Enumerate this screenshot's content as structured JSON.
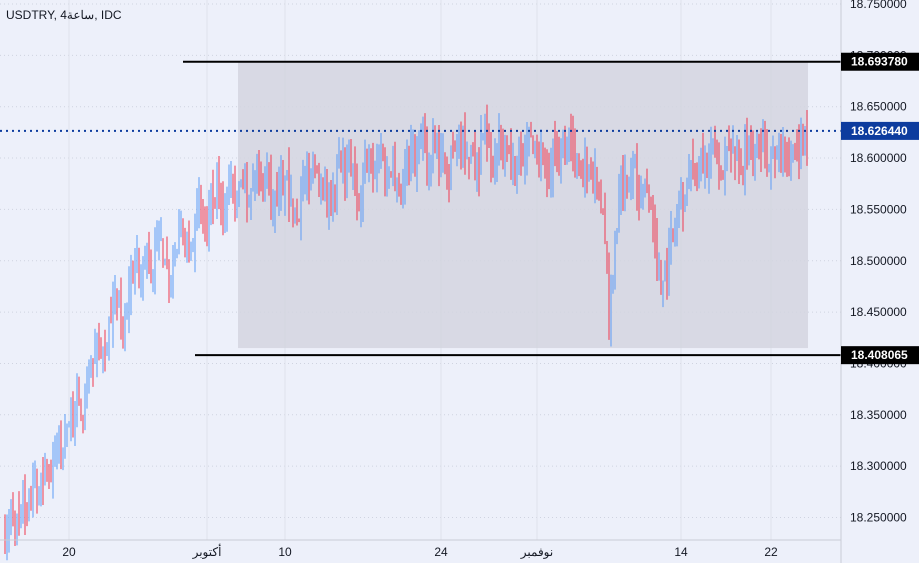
{
  "header": {
    "title": "USDTRY, 4ساعة, IDC"
  },
  "colors": {
    "up": "#5b9cf6",
    "down": "#f0394f",
    "last_price": "#0d3c9e",
    "levels": "#000000",
    "range_box": "#d3d5df"
  },
  "chart_data": {
    "type": "candlestick",
    "title": "USDTRY, 4ساعة, IDC",
    "ylim": [
      18.23,
      18.755
    ],
    "y_ticks": [
      "18.750000",
      "18.700000",
      "18.650000",
      "18.600000",
      "18.550000",
      "18.500000",
      "18.450000",
      "18.400000",
      "18.350000",
      "18.300000",
      "18.250000"
    ],
    "y_tick_values": [
      18.75,
      18.7,
      18.65,
      18.6,
      18.55,
      18.5,
      18.45,
      18.4,
      18.35,
      18.3,
      18.25
    ],
    "x_ticks": [
      {
        "label": "20",
        "index": 11
      },
      {
        "label": "أكتوبر",
        "index": 34
      },
      {
        "label": "10",
        "index": 47
      },
      {
        "label": "24",
        "index": 73
      },
      {
        "label": "نوفمبر",
        "index": 89
      },
      {
        "label": "14",
        "index": 113
      },
      {
        "label": "22",
        "index": 128
      }
    ],
    "closes": [
      18.23,
      18.25,
      18.24,
      18.26,
      18.25,
      18.28,
      18.27,
      18.3,
      18.29,
      18.32,
      18.31,
      18.34,
      18.36,
      18.35,
      18.38,
      18.4,
      18.42,
      18.41,
      18.44,
      18.46,
      18.43,
      18.47,
      18.5,
      18.48,
      18.51,
      18.49,
      18.52,
      18.5,
      18.48,
      18.51,
      18.53,
      18.5,
      18.54,
      18.55,
      18.53,
      18.56,
      18.57,
      18.55,
      18.58,
      18.56,
      18.57,
      18.56,
      18.58,
      18.57,
      18.59,
      18.55,
      18.57,
      18.58,
      18.56,
      18.54,
      18.58,
      18.57,
      18.59,
      18.58,
      18.55,
      18.57,
      18.6,
      18.58,
      18.59,
      18.56,
      18.58,
      18.6,
      18.59,
      18.61,
      18.58,
      18.6,
      18.57,
      18.59,
      18.61,
      18.6,
      18.62,
      18.59,
      18.61,
      18.6,
      18.58,
      18.61,
      18.62,
      18.6,
      18.61,
      18.59,
      18.62,
      18.61,
      18.6,
      18.62,
      18.61,
      18.59,
      18.61,
      18.6,
      18.62,
      18.61,
      18.6,
      18.58,
      18.61,
      18.6,
      18.62,
      18.61,
      18.59,
      18.6,
      18.58,
      18.57,
      18.55,
      18.44,
      18.52,
      18.58,
      18.57,
      18.59,
      18.56,
      18.58,
      18.55,
      18.49,
      18.48,
      18.51,
      18.53,
      18.56,
      18.58,
      18.59,
      18.6,
      18.59,
      18.61,
      18.6,
      18.58,
      18.61,
      18.6,
      18.59,
      18.61,
      18.6,
      18.62,
      18.61,
      18.6,
      18.61,
      18.62,
      18.6,
      18.61,
      18.62,
      18.61
    ],
    "levels": [
      {
        "name": "resistance",
        "value": 18.69378,
        "label": "18.693780",
        "from_index": 30
      },
      {
        "name": "support",
        "value": 18.408065,
        "label": "18.408065",
        "from_index": 32
      }
    ],
    "last_price": {
      "value": 18.62644,
      "label": "18.626440"
    },
    "range_box": {
      "from_index": 40,
      "to_index": 133,
      "top": 18.693,
      "bottom": 18.415
    }
  }
}
